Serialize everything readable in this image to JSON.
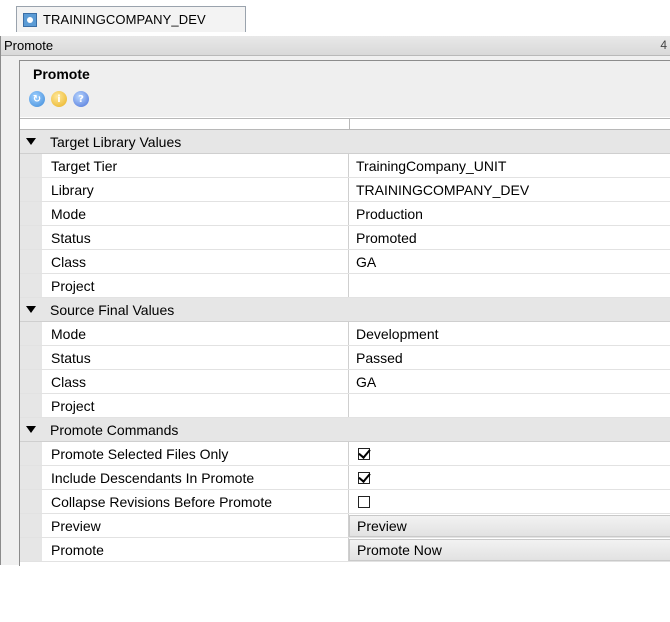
{
  "tab": {
    "label": "TRAININGCOMPANY_DEV",
    "icon": "database-icon"
  },
  "panel": {
    "title": "Promote",
    "pin": "4"
  },
  "header": {
    "title": "Promote",
    "toolbar": [
      {
        "name": "refresh-icon"
      },
      {
        "name": "info-icon",
        "glyph": "i"
      },
      {
        "name": "help-icon",
        "glyph": "?"
      }
    ]
  },
  "sections": [
    {
      "label": "Target Library Values",
      "rows": [
        {
          "name": "Target Tier",
          "value": "TrainingCompany_UNIT"
        },
        {
          "name": "Library",
          "value": "TRAININGCOMPANY_DEV"
        },
        {
          "name": "Mode",
          "value": "Production"
        },
        {
          "name": "Status",
          "value": "Promoted"
        },
        {
          "name": "Class",
          "value": "GA"
        },
        {
          "name": "Project",
          "value": ""
        }
      ]
    },
    {
      "label": "Source Final Values",
      "rows": [
        {
          "name": "Mode",
          "value": "Development"
        },
        {
          "name": "Status",
          "value": "Passed"
        },
        {
          "name": "Class",
          "value": "GA"
        },
        {
          "name": "Project",
          "value": ""
        }
      ]
    },
    {
      "label": "Promote Commands",
      "rows": [
        {
          "name": "Promote Selected Files Only",
          "checked": true
        },
        {
          "name": "Include Descendants In Promote",
          "checked": true
        },
        {
          "name": "Collapse Revisions Before Promote",
          "checked": false
        },
        {
          "name": "Preview",
          "value": "Preview"
        },
        {
          "name": "Promote",
          "value": "Promote Now"
        }
      ]
    }
  ]
}
